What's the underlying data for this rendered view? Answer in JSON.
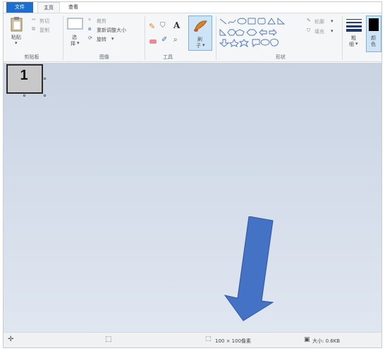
{
  "tabs": {
    "file": "文件",
    "home": "主页",
    "view": "查看"
  },
  "clipboard": {
    "paste": "粘贴",
    "cut": "剪切",
    "copy": "复制",
    "group": "剪贴板"
  },
  "image": {
    "select_top": "选",
    "select_bottom": "择",
    "crop": "裁剪",
    "resize": "重新调整大小",
    "rotate": "旋转",
    "group": "图像"
  },
  "tools": {
    "group": "工具"
  },
  "brushes": {
    "label_top": "刷",
    "label_bottom": "子"
  },
  "shapes": {
    "outline": "轮廓",
    "fill": "填充",
    "group": "形状"
  },
  "size": {
    "label_top": "粗",
    "label_bottom": "细"
  },
  "colors": {
    "color1_top": "颜",
    "color1_bottom": "色"
  },
  "canvas": {
    "image_text": "1"
  },
  "status": {
    "dimensions": "100 × 100像素",
    "filesize": "大小: 0.6KB"
  },
  "accent": {
    "file_tab": "#1c6fd0",
    "arrow": "#4472c4"
  }
}
